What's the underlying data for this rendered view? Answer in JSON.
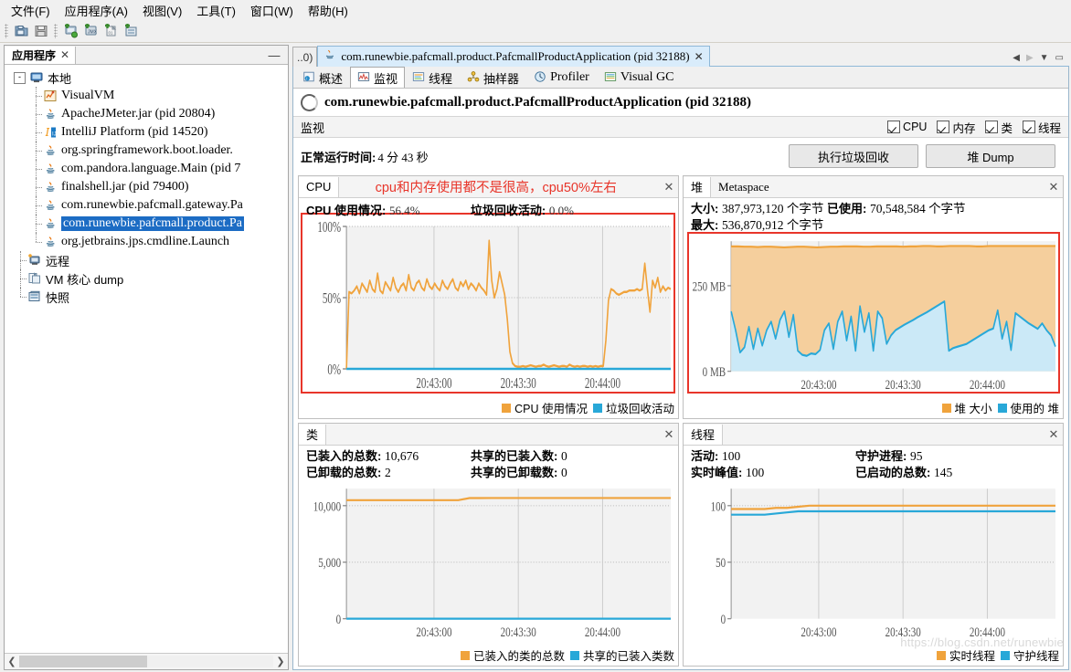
{
  "menu": {
    "items": [
      "文件(F)",
      "应用程序(A)",
      "视图(V)",
      "工具(T)",
      "窗口(W)",
      "帮助(H)"
    ]
  },
  "toolbar": {
    "buttons": [
      "open-icon",
      "save-icon",
      "add-remote-host-icon",
      "add-jmx-connection-icon",
      "add-vm-coredump-icon",
      "add-snapshot-icon"
    ]
  },
  "sidebar": {
    "tab_label": "应用程序",
    "tab_close": "✕",
    "minimize": "—",
    "root": {
      "label": "本地",
      "icon": "computer-icon",
      "expanded": "-"
    },
    "items": [
      {
        "label": "VisualVM",
        "icon": "visualvm-icon",
        "selected": false
      },
      {
        "label": "ApacheJMeter.jar (pid 20804)",
        "icon": "java-icon",
        "selected": false
      },
      {
        "label": "IntelliJ Platform (pid 14520)",
        "icon": "intellij-icon",
        "selected": false
      },
      {
        "label": "org.springframework.boot.loader.",
        "icon": "java-icon",
        "selected": false
      },
      {
        "label": "com.pandora.language.Main (pid 7",
        "icon": "java-icon",
        "selected": false
      },
      {
        "label": "finalshell.jar (pid 79400)",
        "icon": "java-icon",
        "selected": false
      },
      {
        "label": "com.runewbie.pafcmall.gateway.Pa",
        "icon": "java-icon",
        "selected": false
      },
      {
        "label": "com.runewbie.pafcmall.product.Pa",
        "icon": "java-icon",
        "selected": true
      },
      {
        "label": "org.jetbrains.jps.cmdline.Launch",
        "icon": "java-icon",
        "selected": false
      }
    ],
    "roots_extra": [
      {
        "label": "远程",
        "icon": "remote-icon"
      },
      {
        "label": "VM 核心 dump",
        "icon": "coredump-icon"
      },
      {
        "label": "快照",
        "icon": "snapshot-icon"
      }
    ],
    "scroll": {
      "left_arrow": "❮",
      "right_arrow": "❯"
    }
  },
  "document": {
    "inactive_tab": "..0)",
    "active_tab": "com.runewbie.pafcmall.product.PafcmallProductApplication (pid 32188)",
    "active_tab_close": "✕",
    "window_controls": [
      "◀",
      "▶",
      "▼",
      "▭"
    ]
  },
  "subtabs": [
    {
      "label": "概述",
      "icon": "overview-icon",
      "active": false
    },
    {
      "label": "监视",
      "icon": "monitor-icon",
      "active": true
    },
    {
      "label": "线程",
      "icon": "threads-icon",
      "active": false
    },
    {
      "label": "抽样器",
      "icon": "sampler-icon",
      "active": false
    },
    {
      "label": "Profiler",
      "icon": "profiler-icon",
      "active": false
    },
    {
      "label": "Visual GC",
      "icon": "visualgc-icon",
      "active": false
    }
  ],
  "header": {
    "app_title": "com.runewbie.pafcmall.product.PafcmallProductApplication (pid 32188)",
    "section_title": "监视",
    "checkboxes": [
      {
        "label": "CPU",
        "checked": true
      },
      {
        "label": "内存",
        "checked": true
      },
      {
        "label": "类",
        "checked": true
      },
      {
        "label": "线程",
        "checked": true
      }
    ],
    "uptime_label": "正常运行时间:",
    "uptime_value": "4 分 43 秒",
    "gc_button": "执行垃圾回收",
    "heapdump_button": "堆 Dump"
  },
  "annotation": {
    "cpu_note": "cpu和内存使用都不是很高，cpu50%左右",
    "color": "#e8352a"
  },
  "colors": {
    "orange": "#f0a33c",
    "blue": "#28a8d8",
    "heap_fill": "#f5cf9d",
    "used_fill": "#cbe9f7",
    "red": "#e8352a",
    "selection": "#1c6cc4"
  },
  "panels": {
    "cpu": {
      "tab_label": "CPU",
      "close": "✕",
      "chart_title_1": "CPU 使用情况:",
      "chart_value_1": "56.4%",
      "chart_title_2": "垃圾回收活动:",
      "chart_value_2": "0.0%",
      "legend": [
        {
          "label": "CPU 使用情况",
          "color": "#f0a33c"
        },
        {
          "label": "垃圾回收活动",
          "color": "#28a8d8"
        }
      ]
    },
    "heap": {
      "tab_label": "堆",
      "tab_label_2": "Metaspace",
      "close": "✕",
      "size_label": "大小:",
      "size_value": "387,973,120 个字节",
      "used_label": "已使用:",
      "used_value": "70,548,584 个字节",
      "max_label": "最大:",
      "max_value": "536,870,912 个字节",
      "legend": [
        {
          "label": "堆 大小",
          "color": "#f0a33c"
        },
        {
          "label": "使用的 堆",
          "color": "#28a8d8"
        }
      ]
    },
    "classes": {
      "tab_label": "类",
      "close": "✕",
      "loaded_label": "已装入的总数:",
      "loaded_value": "10,676",
      "shared_loaded_label": "共享的已装入数:",
      "shared_loaded_value": "0",
      "unloaded_label": "已卸载的总数:",
      "unloaded_value": "2",
      "shared_unloaded_label": "共享的已卸载数:",
      "shared_unloaded_value": "0",
      "legend": [
        {
          "label": "已装入的类的总数",
          "color": "#f0a33c"
        },
        {
          "label": "共享的已装入类数",
          "color": "#28a8d8"
        }
      ]
    },
    "threads": {
      "tab_label": "线程",
      "close": "✕",
      "live_label": "活动:",
      "live_value": "100",
      "daemon_label": "守护进程:",
      "daemon_value": "95",
      "peak_label": "实时峰值:",
      "peak_value": "100",
      "started_label": "已启动的总数:",
      "started_value": "145",
      "legend": [
        {
          "label": "实时线程",
          "color": "#f0a33c"
        },
        {
          "label": "守护线程",
          "color": "#28a8d8"
        }
      ]
    }
  },
  "watermark": "https://blog.csdn.net/runewbie",
  "chart_data": [
    {
      "type": "line",
      "id": "cpu-chart",
      "title": "CPU 使用情况 / 垃圾回收活动",
      "xlabel": "",
      "ylabel": "",
      "ylim": [
        0,
        100
      ],
      "yticks": [
        0,
        50,
        100
      ],
      "ytick_labels": [
        "0%",
        "50%",
        "100%"
      ],
      "xticks": [
        "20:43:00",
        "20:43:30",
        "20:44:00"
      ],
      "grid": true,
      "legend_position": "bottom-right",
      "series": [
        {
          "name": "CPU 使用情况",
          "color": "#f0a33c",
          "values": [
            0,
            54,
            53,
            55,
            58,
            53,
            60,
            57,
            54,
            62,
            56,
            54,
            67,
            55,
            53,
            61,
            58,
            55,
            64,
            57,
            54,
            58,
            60,
            55,
            66,
            57,
            55,
            60,
            62,
            57,
            55,
            63,
            58,
            56,
            60,
            57,
            55,
            62,
            58,
            56,
            60,
            63,
            57,
            55,
            61,
            58,
            62,
            56,
            60,
            58,
            55,
            60,
            57,
            55,
            52,
            90,
            62,
            50,
            56,
            68,
            60,
            52,
            35,
            12,
            4,
            2,
            1.5,
            1.5,
            2,
            1.5,
            2,
            2.5,
            2,
            1.5,
            2,
            2,
            3,
            2,
            1.5,
            2,
            2.5,
            2,
            1.5,
            2,
            2,
            1.5,
            3,
            2,
            1.5,
            2,
            1.5,
            2,
            2,
            1.5,
            2,
            1.5,
            2,
            1.5,
            2,
            2,
            20,
            48,
            56,
            55,
            53,
            52,
            53,
            54,
            54,
            55,
            55,
            55,
            56,
            55,
            56,
            74,
            56,
            40,
            62,
            57,
            64,
            54,
            58,
            55,
            57,
            56
          ]
        },
        {
          "name": "垃圾回收活动",
          "color": "#28a8d8",
          "values": [
            0,
            0,
            0,
            0,
            0,
            0,
            0,
            0,
            0,
            0,
            0,
            0,
            0,
            0,
            0,
            0,
            0,
            0,
            0,
            0
          ]
        }
      ]
    },
    {
      "type": "area",
      "id": "heap-chart",
      "title": "堆大小 / 使用的堆",
      "ylim": [
        0,
        380
      ],
      "yticks": [
        0,
        250
      ],
      "ytick_labels": [
        "0 MB",
        "250 MB"
      ],
      "xticks": [
        "20:43:00",
        "20:43:30",
        "20:44:00"
      ],
      "grid": true,
      "legend_position": "bottom-right",
      "series": [
        {
          "name": "堆 大小",
          "color": "#f0a33c",
          "fill": "#f5cf9d",
          "values": [
            365,
            365,
            364,
            364,
            363,
            364,
            364,
            363,
            362,
            363,
            364,
            364,
            363,
            362,
            363,
            364,
            364,
            365,
            365,
            365,
            364,
            364,
            365,
            365,
            365,
            365,
            364,
            365,
            365,
            366,
            366,
            365,
            365,
            366,
            366,
            366,
            366,
            365,
            365,
            366,
            366,
            366,
            366,
            366,
            366,
            366,
            366,
            366,
            366,
            366
          ]
        },
        {
          "name": "使用的 堆",
          "color": "#28a8d8",
          "fill": "#cbe9f7",
          "values": [
            175,
            120,
            55,
            70,
            130,
            65,
            125,
            75,
            120,
            145,
            95,
            150,
            175,
            100,
            165,
            60,
            48,
            45,
            52,
            50,
            62,
            120,
            140,
            65,
            145,
            175,
            90,
            160,
            60,
            190,
            115,
            170,
            60,
            175,
            155,
            80,
            105,
            120,
            128,
            136,
            143,
            150,
            158,
            165,
            172,
            180,
            188,
            196,
            204,
            60,
            68,
            72,
            76,
            80,
            88,
            96,
            104,
            112,
            120,
            125,
            178,
            95,
            145,
            62,
            170,
            160,
            150,
            140,
            132,
            124,
            140,
            120,
            105,
            72
          ]
        }
      ]
    },
    {
      "type": "line",
      "id": "classes-chart",
      "title": "已装入的类的总数 / 共享的已装入类数",
      "ylim": [
        0,
        11500
      ],
      "yticks": [
        0,
        5000,
        10000
      ],
      "ytick_labels": [
        "0",
        "5,000",
        "10,000"
      ],
      "xticks": [
        "20:43:00",
        "20:43:30",
        "20:44:00"
      ],
      "grid": true,
      "legend_position": "bottom-right",
      "series": [
        {
          "name": "已装入的类的总数",
          "color": "#f0a33c",
          "values": [
            10480,
            10480,
            10480,
            10480,
            10480,
            10480,
            10480,
            10480,
            10480,
            10480,
            10480,
            10670,
            10672,
            10673,
            10674,
            10674,
            10675,
            10675,
            10675,
            10676,
            10676,
            10676,
            10676,
            10676,
            10676,
            10676,
            10676,
            10676,
            10676,
            10676
          ]
        },
        {
          "name": "共享的已装入类数",
          "color": "#28a8d8",
          "values": [
            0,
            0,
            0,
            0,
            0,
            0,
            0,
            0,
            0,
            0,
            0,
            0,
            0,
            0,
            0,
            0,
            0,
            0,
            0,
            0
          ]
        }
      ]
    },
    {
      "type": "line",
      "id": "threads-chart",
      "title": "实时线程 / 守护线程",
      "ylim": [
        0,
        115
      ],
      "yticks": [
        0,
        50,
        100
      ],
      "ytick_labels": [
        "0",
        "50",
        "100"
      ],
      "xticks": [
        "20:43:00",
        "20:43:30",
        "20:44:00"
      ],
      "grid": true,
      "legend_position": "bottom-right",
      "series": [
        {
          "name": "实时线程",
          "color": "#f0a33c",
          "values": [
            97,
            97,
            97,
            97,
            98,
            98,
            99,
            100,
            100,
            100,
            100,
            100,
            100,
            100,
            100,
            100,
            100,
            100,
            100,
            100,
            100,
            100,
            100,
            100,
            100,
            100,
            100,
            100,
            100,
            100
          ]
        },
        {
          "name": "守护线程",
          "color": "#28a8d8",
          "values": [
            92,
            92,
            92,
            92,
            93,
            94,
            95,
            95,
            95,
            95,
            95,
            95,
            95,
            95,
            95,
            95,
            95,
            95,
            95,
            95,
            95,
            95,
            95,
            95,
            95,
            95,
            95,
            95,
            95,
            95
          ]
        }
      ]
    }
  ]
}
